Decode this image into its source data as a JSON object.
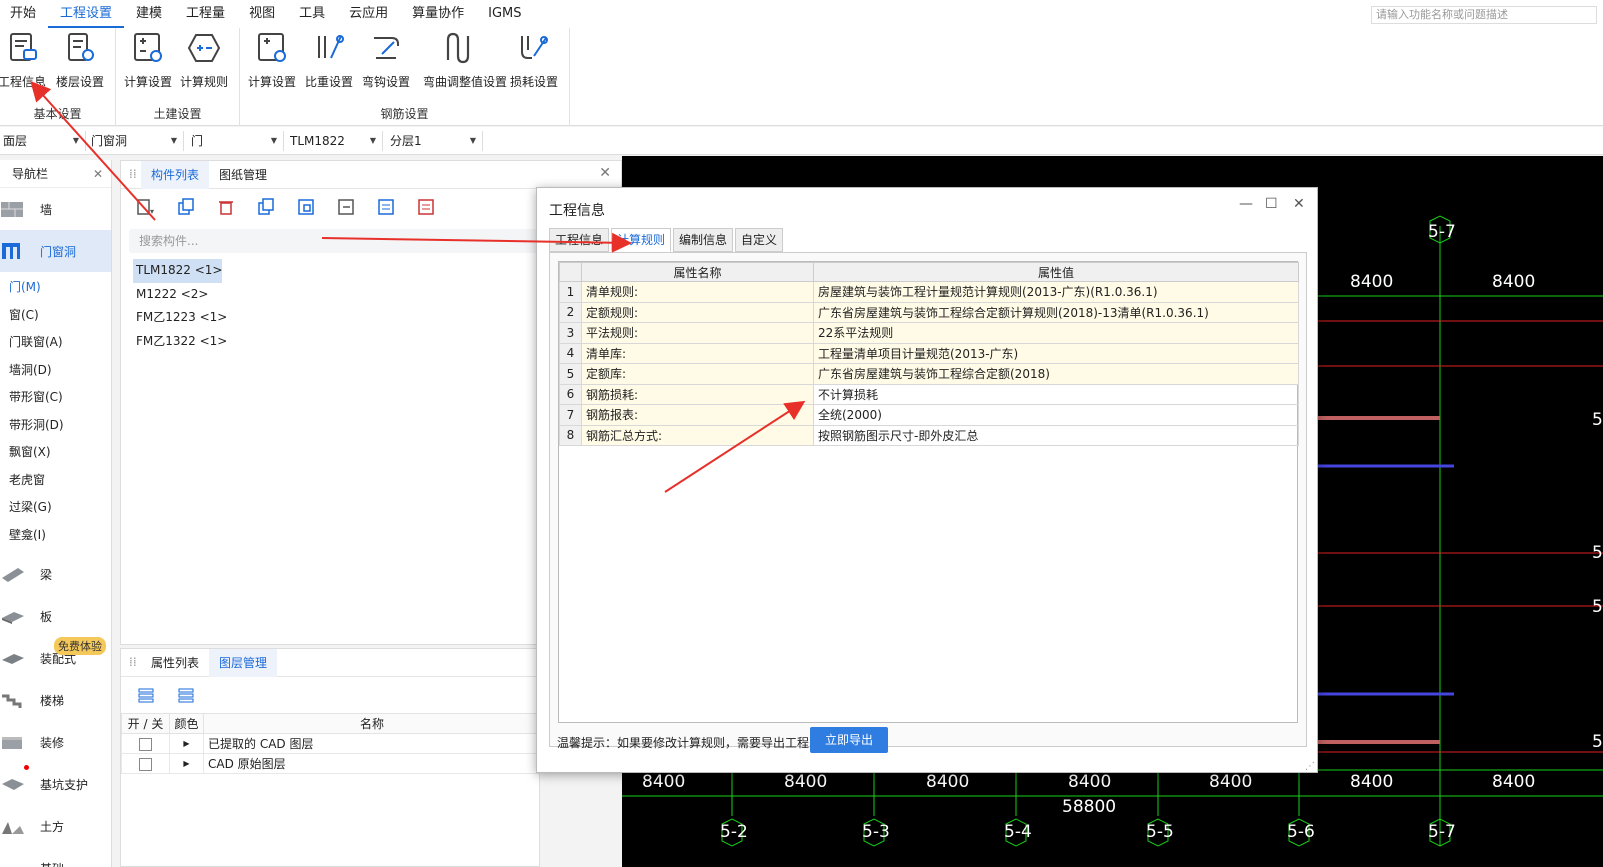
{
  "menu": [
    "开始",
    "工程设置",
    "建模",
    "工程量",
    "视图",
    "工具",
    "云应用",
    "算量协作",
    "IGMS"
  ],
  "search_placeholder": "请输入功能名称或问题描述",
  "ribbon": {
    "groups": [
      {
        "label": "基本设置",
        "buttons": [
          "工程信息",
          "楼层设置"
        ]
      },
      {
        "label": "土建设置",
        "buttons": [
          "计算设置",
          "计算规则"
        ]
      },
      {
        "label": "钢筋设置",
        "buttons": [
          "计算设置",
          "比重设置",
          "弯钩设置",
          "弯曲调整值设置",
          "损耗设置"
        ]
      }
    ]
  },
  "selectors": [
    "面层",
    "门窗洞",
    "门",
    "TLM1822",
    "分层1"
  ],
  "nav": {
    "title": "导航栏",
    "categories_top": [
      "墙",
      "门窗洞"
    ],
    "subitems": [
      "门(M)",
      "窗(C)",
      "门联窗(A)",
      "墙洞(D)",
      "带形窗(C)",
      "带形洞(D)",
      "飘窗(X)",
      "老虎窗",
      "过梁(G)",
      "壁龛(I)"
    ],
    "categories_bottom": [
      "梁",
      "板",
      "装配式",
      "楼梯",
      "装修",
      "基坑支护",
      "土方",
      "基础"
    ],
    "trial_badge": "免费体验"
  },
  "comp_panel": {
    "tabs": [
      "构件列表",
      "图纸管理"
    ],
    "search_placeholder": "搜索构件...",
    "items": [
      "TLM1822 <1>",
      "M1222 <2>",
      "FM乙1223 <1>",
      "FM乙1322 <1>"
    ]
  },
  "layer_panel": {
    "tabs": [
      "属性列表",
      "图层管理"
    ],
    "headers": [
      "开 / 关",
      "颜色",
      "名称"
    ],
    "rows": [
      "已提取的 CAD 图层",
      "CAD 原始图层"
    ]
  },
  "dialog": {
    "title": "工程信息",
    "tabs": [
      "工程信息",
      "计算规则",
      "编制信息",
      "自定义"
    ],
    "headers": [
      "属性名称",
      "属性值"
    ],
    "rows": [
      {
        "n": "1",
        "k": "清单规则:",
        "v": "房屋建筑与装饰工程计量规范计算规则(2013-广东)(R1.0.36.1)"
      },
      {
        "n": "2",
        "k": "定额规则:",
        "v": "广东省房屋建筑与装饰工程综合定额计算规则(2018)-13清单(R1.0.36.1)"
      },
      {
        "n": "3",
        "k": "平法规则:",
        "v": "22系平法规则"
      },
      {
        "n": "4",
        "k": "清单库:",
        "v": "工程量清单项目计量规范(2013-广东)"
      },
      {
        "n": "5",
        "k": "定额库:",
        "v": "广东省房屋建筑与装饰工程综合定额(2018)"
      },
      {
        "n": "6",
        "k": "钢筋损耗:",
        "v": "不计算损耗"
      },
      {
        "n": "7",
        "k": "钢筋报表:",
        "v": "全统(2000)"
      },
      {
        "n": "8",
        "k": "钢筋汇总方式:",
        "v": "按照钢筋图示尺寸-即外皮汇总"
      }
    ],
    "hint": "温馨提示：如果要修改计算规则，需要导出工程",
    "export_label": "立即导出"
  },
  "cad": {
    "top_dims": [
      "8400",
      "8400"
    ],
    "top_axis": "5-7",
    "bottom_dims": [
      "8400",
      "8400",
      "8400",
      "8400",
      "8400",
      "8400",
      "8400"
    ],
    "total": "58800",
    "bottom_axes": [
      "5-2",
      "5-3",
      "5-4",
      "5-5",
      "5-6",
      "5-7"
    ],
    "right_labels": [
      "5",
      "5",
      "5",
      "5"
    ]
  }
}
